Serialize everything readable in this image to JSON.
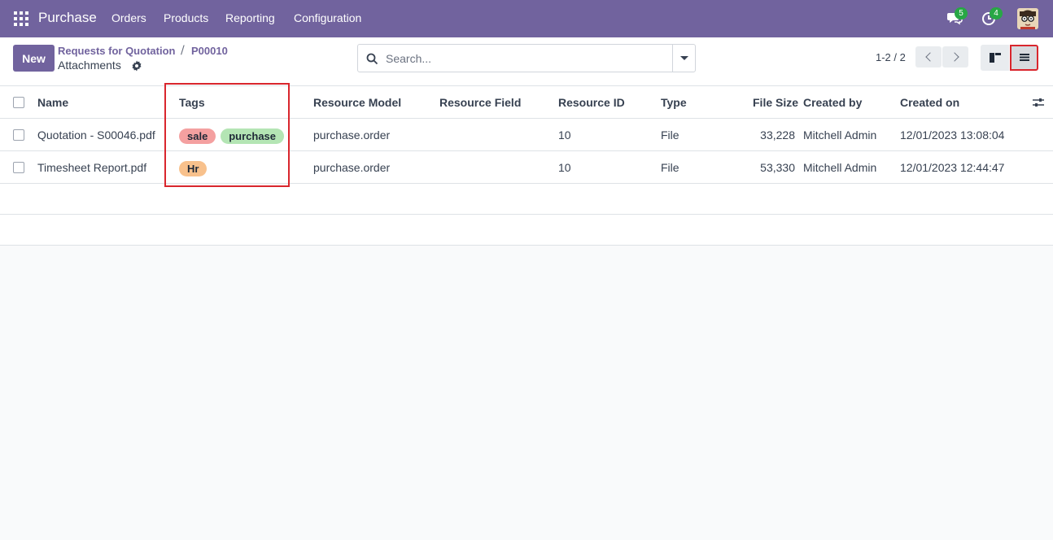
{
  "navbar": {
    "brand": "Purchase",
    "menu": [
      "Orders",
      "Products",
      "Reporting",
      "Configuration"
    ],
    "messages_count": "5",
    "activities_count": "4"
  },
  "control": {
    "new_label": "New",
    "breadcrumb": [
      "Requests for Quotation",
      "P00010"
    ],
    "separator": "/",
    "title": "Attachments",
    "search_placeholder": "Search...",
    "pager": "1-2 / 2"
  },
  "table": {
    "columns": [
      "Name",
      "Tags",
      "Resource Model",
      "Resource Field",
      "Resource ID",
      "Type",
      "File Size",
      "Created by",
      "Created on"
    ],
    "rows": [
      {
        "name": "Quotation - S00046.pdf",
        "tags": [
          "sale",
          "purchase"
        ],
        "resource_model": "purchase.order",
        "resource_field": "",
        "resource_id": "10",
        "type": "File",
        "file_size": "33,228",
        "created_by": "Mitchell Admin",
        "created_on": "12/01/2023 13:08:04"
      },
      {
        "name": "Timesheet Report.pdf",
        "tags": [
          "Hr"
        ],
        "resource_model": "purchase.order",
        "resource_field": "",
        "resource_id": "10",
        "type": "File",
        "file_size": "53,330",
        "created_by": "Mitchell Admin",
        "created_on": "12/01/2023 12:44:47"
      }
    ]
  },
  "colors": {
    "brand": "#71639e",
    "highlight": "#d9262d",
    "tag_sale": "#f4a0a0",
    "tag_purchase": "#b4e5b4",
    "tag_hr": "#f8c18c"
  }
}
